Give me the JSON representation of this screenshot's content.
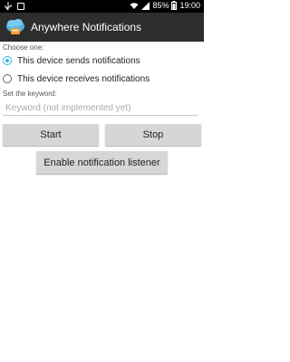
{
  "status_bar": {
    "battery": "85%",
    "time": "19:00"
  },
  "app": {
    "title": "Anywhere Notifications"
  },
  "mode": {
    "label": "Choose one:",
    "options": [
      {
        "label": "This device sends notifications",
        "checked": true
      },
      {
        "label": "This device receives notifications",
        "checked": false
      }
    ]
  },
  "keyword": {
    "label": "Set the keyword:",
    "placeholder": "Keyword (not implemented yet)",
    "value": ""
  },
  "buttons": {
    "start": "Start",
    "stop": "Stop",
    "enable_listener": "Enable notification listener"
  },
  "colors": {
    "accent": "#33b5e5",
    "action_bar": "#2d2d2d",
    "button": "#d6d6d6"
  }
}
